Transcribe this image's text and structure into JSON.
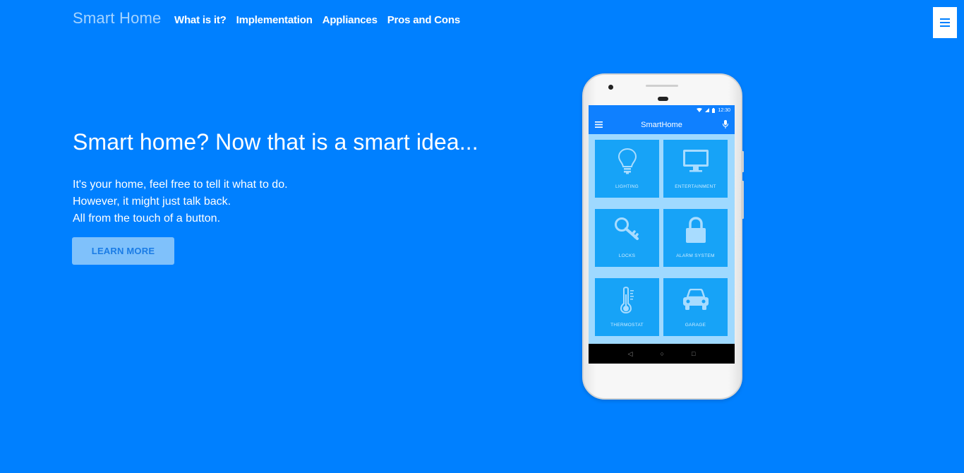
{
  "nav": {
    "brand": "Smart Home",
    "links": [
      "What is it?",
      "Implementation",
      "Appliances",
      "Pros and Cons"
    ],
    "menu_icon": "hamburger-icon"
  },
  "hero": {
    "title": "Smart home? Now that is a smart idea...",
    "lines": [
      "It's your home, feel free to tell it what to do.",
      "However, it might just talk back.",
      "All from the touch of a button."
    ],
    "cta": "LEARN MORE"
  },
  "phone": {
    "status_time": "12:30",
    "app_title": "SmartHome",
    "tiles": [
      {
        "label": "LIGHTING",
        "icon": "lightbulb-icon"
      },
      {
        "label": "ENTERTAINMENT",
        "icon": "monitor-icon"
      },
      {
        "label": "LOCKS",
        "icon": "key-icon"
      },
      {
        "label": "ALARM SYSTEM",
        "icon": "padlock-icon"
      },
      {
        "label": "THERMOSTAT",
        "icon": "thermometer-icon"
      },
      {
        "label": "GARAGE",
        "icon": "car-icon"
      }
    ]
  },
  "colors": {
    "background": "#0080ff",
    "brand": "#a6d4ff",
    "button_bg": "#7fc1fb",
    "tile": "#17a3f7"
  }
}
